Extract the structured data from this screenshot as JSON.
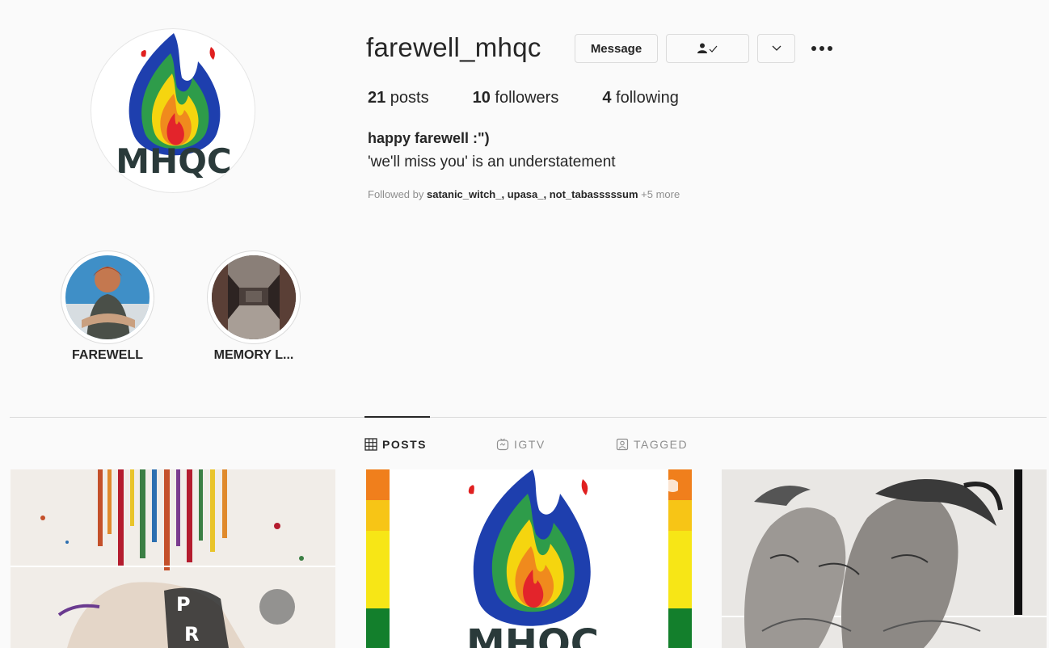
{
  "profile": {
    "username": "farewell_mhqc",
    "buttons": {
      "message_label": "Message",
      "more_icon": "ellipsis-icon",
      "following_icon": "person-check-icon",
      "suggest_icon": "chevron-down-icon"
    },
    "stats": [
      {
        "count": "21",
        "label": " posts"
      },
      {
        "count": "10",
        "label": " followers"
      },
      {
        "count": "4",
        "label": " following"
      }
    ],
    "bio_name": "happy farewell :\")",
    "bio_text": "'we'll miss you' is an understatement",
    "followed_by": {
      "prefix": "Followed by ",
      "names": "satanic_witch_, upasa_, not_tabasssssum",
      "more": " +5 more"
    },
    "avatar_text": "MHQC"
  },
  "highlights": [
    {
      "label": "FAREWELL"
    },
    {
      "label": "MEMORY L..."
    }
  ],
  "tabs": [
    {
      "label": "POSTS",
      "icon": "grid-icon",
      "active": true
    },
    {
      "label": "IGTV",
      "icon": "igtv-icon",
      "active": false
    },
    {
      "label": "TAGGED",
      "icon": "tagged-icon",
      "active": false
    }
  ],
  "post_2_text": "MHQC",
  "colors": {
    "background": "#fafafa",
    "text": "#262626",
    "muted": "#8e8e8e",
    "border": "#dbdbdb"
  }
}
